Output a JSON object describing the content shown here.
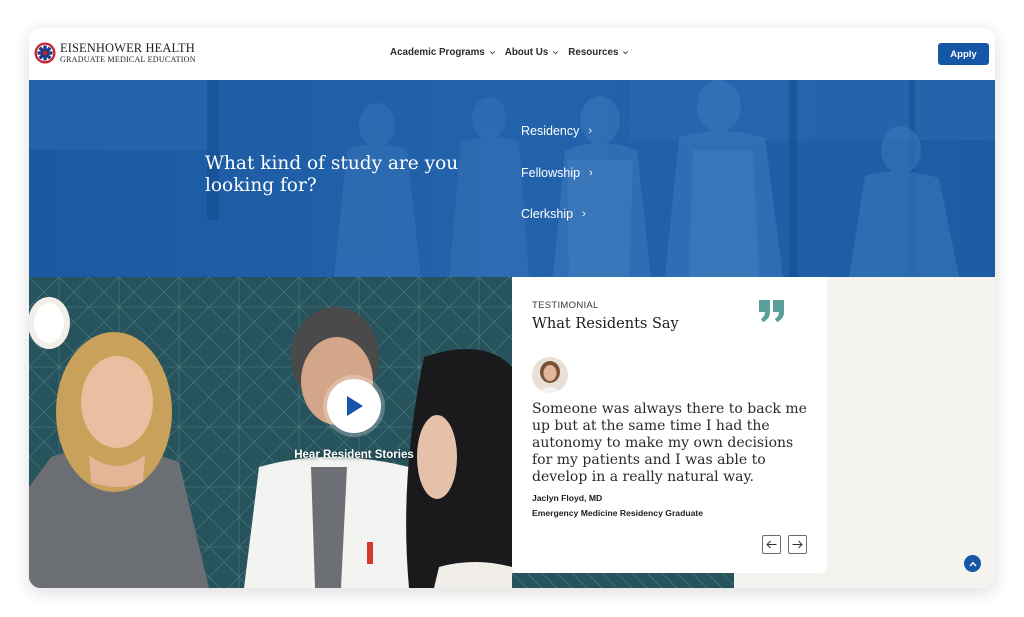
{
  "brand": {
    "name_line1": "EISENHOWER HEALTH",
    "name_line2": "GRADUATE MEDICAL EDUCATION"
  },
  "nav": {
    "items": [
      {
        "label": "Academic Programs"
      },
      {
        "label": "About Us"
      },
      {
        "label": "Resources"
      }
    ],
    "apply_label": "Apply"
  },
  "hero": {
    "title": "What kind of study are you looking for?",
    "links": [
      {
        "label": "Residency"
      },
      {
        "label": "Fellowship"
      },
      {
        "label": "Clerkship"
      }
    ]
  },
  "video": {
    "label": "Hear Resident Stories"
  },
  "testimonial": {
    "eyebrow": "TESTIMONIAL",
    "title": "What Residents Say",
    "quote": "Someone was always there to back me up but at the same time I had the autonomy to make my own decisions for my patients and I was able to develop in a really natural way.",
    "author": "Jaclyn Floyd, MD",
    "role": "Emergency Medicine Residency Graduate"
  },
  "colors": {
    "primary_blue": "#1556a6",
    "quote_teal": "#5a9f9a",
    "sand_background": "#f5f3ef"
  },
  "icons": {
    "prev": "arrow-left-icon",
    "next": "arrow-right-icon",
    "scroll_top": "chevron-up-icon",
    "quote": "quote-icon",
    "play": "play-icon"
  }
}
